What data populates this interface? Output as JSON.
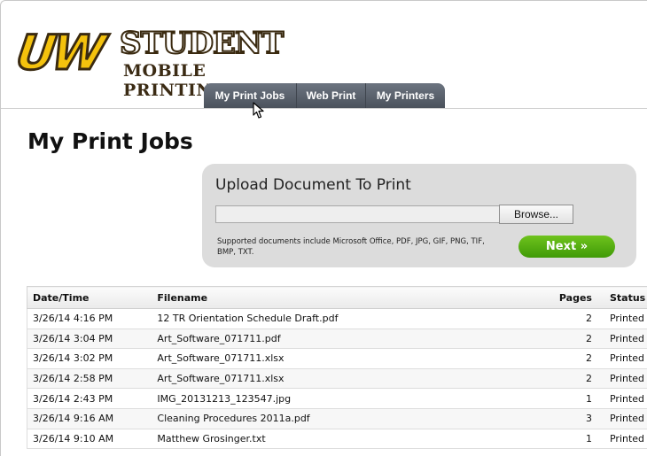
{
  "logo": {
    "uw": "UW",
    "student": "STUDENT",
    "subtitle": "MOBILE PRINTING"
  },
  "nav": {
    "tabs": [
      {
        "label": "My Print Jobs"
      },
      {
        "label": "Web Print"
      },
      {
        "label": "My Printers"
      }
    ]
  },
  "page": {
    "title": "My Print Jobs"
  },
  "upload": {
    "title": "Upload Document To Print",
    "file_value": "",
    "browse_label": "Browse...",
    "supported_text": "Supported documents include Microsoft Office, PDF, JPG, GIF, PNG, TIF, BMP, TXT.",
    "next_label": "Next »"
  },
  "table": {
    "headers": {
      "datetime": "Date/Time",
      "filename": "Filename",
      "pages": "Pages",
      "status": "Status"
    },
    "rows": [
      {
        "datetime": "3/26/14 4:16 PM",
        "filename": "12 TR Orientation Schedule Draft.pdf",
        "pages": "2",
        "status": "Printed"
      },
      {
        "datetime": "3/26/14 3:04 PM",
        "filename": "Art_Software_071711.pdf",
        "pages": "2",
        "status": "Printed"
      },
      {
        "datetime": "3/26/14 3:02 PM",
        "filename": "Art_Software_071711.xlsx",
        "pages": "2",
        "status": "Printed"
      },
      {
        "datetime": "3/26/14 2:58 PM",
        "filename": "Art_Software_071711.xlsx",
        "pages": "2",
        "status": "Printed"
      },
      {
        "datetime": "3/26/14 2:43 PM",
        "filename": "IMG_20131213_123547.jpg",
        "pages": "1",
        "status": "Printed"
      },
      {
        "datetime": "3/26/14 9:16 AM",
        "filename": "Cleaning Procedures 2011a.pdf",
        "pages": "3",
        "status": "Printed"
      },
      {
        "datetime": "3/26/14 9:10 AM",
        "filename": "Matthew Grosinger.txt",
        "pages": "1",
        "status": "Printed"
      }
    ]
  }
}
